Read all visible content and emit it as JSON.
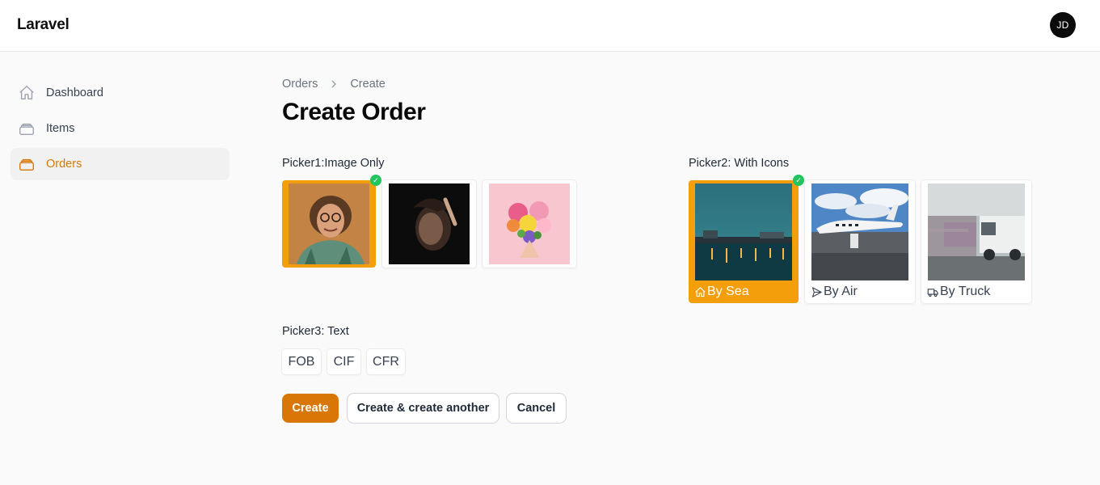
{
  "app": {
    "brand": "Laravel",
    "user_initials": "JD"
  },
  "sidebar": {
    "items": [
      {
        "label": "Dashboard",
        "icon": "home-icon",
        "active": false
      },
      {
        "label": "Items",
        "icon": "rectangle-stack-icon",
        "active": false
      },
      {
        "label": "Orders",
        "icon": "rectangle-stack-icon",
        "active": true
      }
    ]
  },
  "breadcrumb": {
    "items": [
      "Orders",
      "Create"
    ]
  },
  "page": {
    "title": "Create Order"
  },
  "picker1": {
    "label": "Picker1:Image Only",
    "options": [
      {
        "name": "man-with-glasses-photo",
        "selected": true
      },
      {
        "name": "dark-portrait-photo",
        "selected": false
      },
      {
        "name": "flower-heart-photo",
        "selected": false
      }
    ]
  },
  "picker2": {
    "label": "Picker2: With Icons",
    "options": [
      {
        "label": "By Sea",
        "icon": "home-icon",
        "selected": true
      },
      {
        "label": "By Air",
        "icon": "paper-airplane-icon",
        "selected": false
      },
      {
        "label": "By Truck",
        "icon": "truck-icon",
        "selected": false
      }
    ]
  },
  "picker3": {
    "label": "Picker3: Text",
    "options": [
      "FOB",
      "CIF",
      "CFR"
    ]
  },
  "actions": {
    "create": "Create",
    "create_another": "Create & create another",
    "cancel": "Cancel"
  },
  "colors": {
    "accent": "#d97706",
    "selected": "#f59e0b",
    "check": "#22c55e"
  }
}
